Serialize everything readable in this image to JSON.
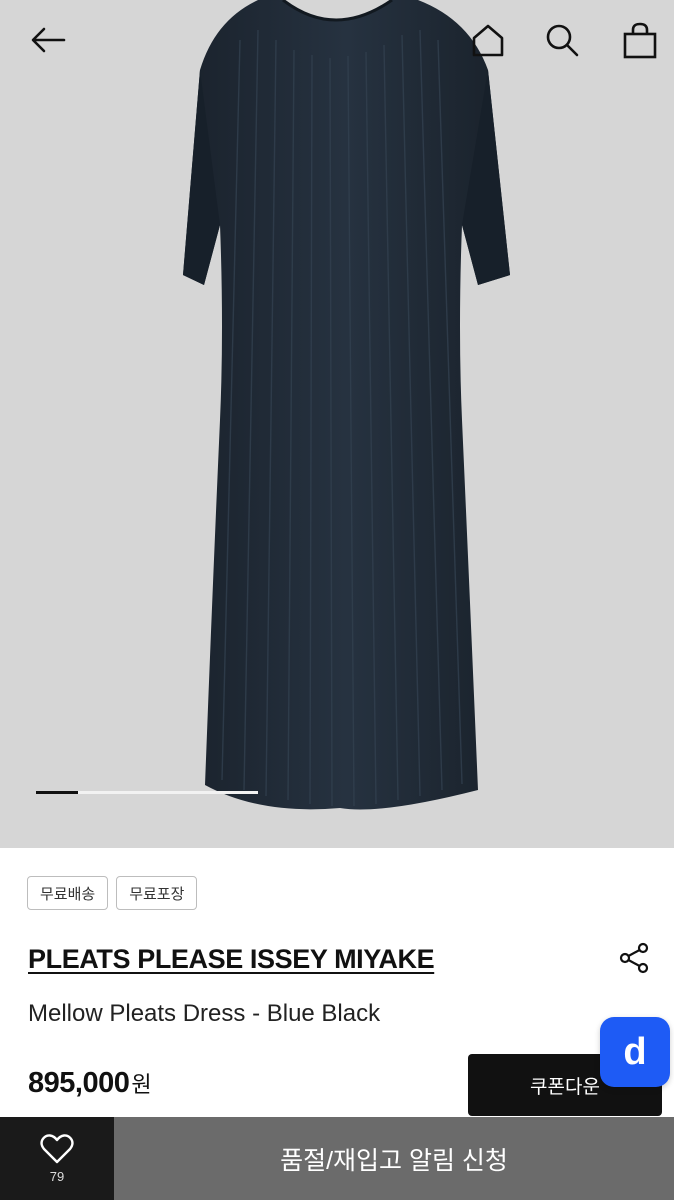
{
  "header": {
    "back_icon": "arrow-left-icon",
    "home_icon": "home-icon",
    "search_icon": "search-icon",
    "cart_icon": "shopping-bag-icon"
  },
  "gallery": {
    "image": "navy pleated midi dress with half sleeves",
    "progress": 0.19
  },
  "tags": [
    "무료배송",
    "무료포장"
  ],
  "product": {
    "brand": "PLEATS PLEASE ISSEY MIYAKE",
    "name": "Mellow Pleats Dress - Blue Black",
    "price": "895,000",
    "currency": "원",
    "share_icon": "share-icon"
  },
  "coupon_button": {
    "label": "쿠폰다운"
  },
  "floating_button": {
    "label": "d",
    "color": "#1e5bf5"
  },
  "bottom_bar": {
    "wish_icon": "heart-icon",
    "wish_count": "79",
    "restock_label": "품절/재입고 알림 신청"
  },
  "colors": {
    "hero_bg": "#d6d6d6",
    "dress": "#1c2530",
    "bottom_dark": "#1a1a1a",
    "bottom_gray": "#6b6b6b"
  }
}
